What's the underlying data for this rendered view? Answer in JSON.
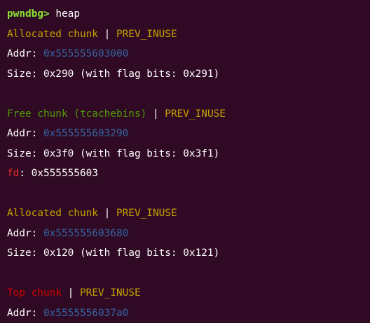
{
  "terminal": {
    "prompt": "pwndbg>",
    "command": "heap",
    "chunks": [
      {
        "header": "Allocated chunk",
        "separator": "|",
        "flag": "PREV_INUSE",
        "addr_label": "Addr:",
        "addr": "0x555555603000",
        "size_line": "Size: 0x290 (with flag bits: 0x291)"
      },
      {
        "header": "Free chunk (tcachebins)",
        "separator": "|",
        "flag": "PREV_INUSE",
        "addr_label": "Addr:",
        "addr": "0x555555603290",
        "size_line": "Size: 0x3f0 (with flag bits: 0x3f1)",
        "fd_label": "fd",
        "fd_value": ": 0x555555603"
      },
      {
        "header": "Allocated chunk",
        "separator": "|",
        "flag": "PREV_INUSE",
        "addr_label": "Addr:",
        "addr": "0x555555603680",
        "size_line": "Size: 0x120 (with flag bits: 0x121)"
      },
      {
        "header": "Top chunk",
        "separator": "|",
        "flag": "PREV_INUSE",
        "addr_label": "Addr:",
        "addr": "0x5555556037a0"
      }
    ]
  },
  "colors": {
    "background": "#300a24",
    "prompt": "#8ae234",
    "allocated": "#c4a000",
    "free": "#4e9a06",
    "top": "#cc0000",
    "address": "#3465a4",
    "fd": "#ef2929"
  }
}
